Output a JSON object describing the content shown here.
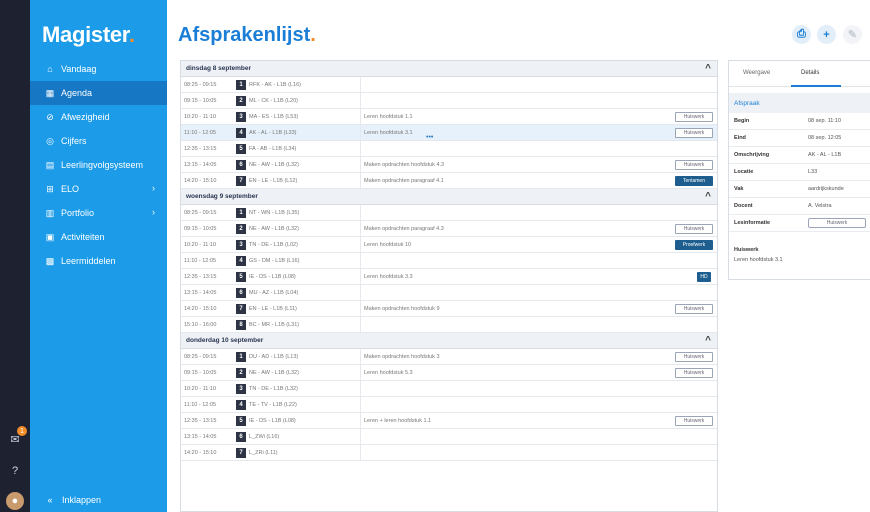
{
  "app": {
    "logo": "Magister",
    "logo_dot": "."
  },
  "strip": {
    "badge_count": "1"
  },
  "sidebar": {
    "items": [
      {
        "label": "Vandaag",
        "icon": "home-icon",
        "glyph": "⌂"
      },
      {
        "label": "Agenda",
        "icon": "calendar-icon",
        "glyph": "▦",
        "active": true
      },
      {
        "label": "Afwezigheid",
        "icon": "check-circle-icon",
        "glyph": "⊘"
      },
      {
        "label": "Cijfers",
        "icon": "grades-icon",
        "glyph": "◎"
      },
      {
        "label": "Leerlingvolgsysteem",
        "icon": "report-icon",
        "glyph": "▤"
      },
      {
        "label": "ELO",
        "icon": "elo-icon",
        "glyph": "⊞",
        "chevron": "›"
      },
      {
        "label": "Portfolio",
        "icon": "portfolio-icon",
        "glyph": "▥",
        "chevron": "›"
      },
      {
        "label": "Activiteiten",
        "icon": "activities-icon",
        "glyph": "▣"
      },
      {
        "label": "Leermiddelen",
        "icon": "books-icon",
        "glyph": "▩"
      }
    ],
    "collapse_label": "Inklappen",
    "collapse_glyph": "«"
  },
  "header": {
    "title": "Afsprakenlijst",
    "title_dot": ".",
    "print_glyph": "⎙",
    "add_glyph": "+",
    "edit_glyph": "✎"
  },
  "schedule": {
    "days": [
      {
        "label": "dinsdag 8 september",
        "rows": [
          {
            "time": "08:25 - 09:15",
            "hour": "1",
            "cls": "RFK - AK - L1B (L16)",
            "info": ""
          },
          {
            "time": "09:15 - 10:05",
            "hour": "2",
            "cls": "ML - CK - L1B (L20)",
            "info": ""
          },
          {
            "time": "10:20 - 11:10",
            "hour": "3",
            "cls": "MA - ES - L1B (L53)",
            "info": "Leren hoofdstuk 1.1",
            "badge": "Huiswerk",
            "badge_type": "outline"
          },
          {
            "time": "11:10 - 12:05",
            "hour": "4",
            "cls": "AK - AL - L1B (L33)",
            "info": "Leren hoofdstuk 3.1",
            "badge": "Huiswerk",
            "badge_type": "outline",
            "selected": true,
            "dots": "•••"
          },
          {
            "time": "12:35 - 13:15",
            "hour": "5",
            "cls": "FA - AB - L1B (L34)",
            "info": ""
          },
          {
            "time": "13:15 - 14:05",
            "hour": "6",
            "cls": "NE - AW - L1B (L32)",
            "info": "Maken opdrachten hoofdstuk 4.3",
            "badge": "Huiswerk",
            "badge_type": "outline"
          },
          {
            "time": "14:20 - 15:10",
            "hour": "7",
            "cls": "EN - LE - L1B (L12)",
            "info": "Maken opdrachten paragraaf 4.1",
            "badge": "Tentamen",
            "badge_type": "solid"
          }
        ]
      },
      {
        "label": "woensdag 9 september",
        "rows": [
          {
            "time": "08:25 - 09:15",
            "hour": "1",
            "cls": "NT - WN - L1B (L35)",
            "info": ""
          },
          {
            "time": "09:15 - 10:05",
            "hour": "2",
            "cls": "NE - AW - L1B (L32)",
            "info": "Maken opdrachten paragraaf 4.3",
            "badge": "Huiswerk",
            "badge_type": "outline"
          },
          {
            "time": "10:20 - 11:10",
            "hour": "3",
            "cls": "TN - DE - L1B (L02)",
            "info": "Leren hoofdstuk 10",
            "badge": "Proefwerk",
            "badge_type": "solid"
          },
          {
            "time": "11:10 - 12:05",
            "hour": "4",
            "cls": "GS - DM - L1B (L16)",
            "info": ""
          },
          {
            "time": "12:35 - 13:15",
            "hour": "5",
            "cls": "IE - DS - L1B (L08)",
            "info": "Leren hoofdstuk 3.3",
            "badge": "HD",
            "badge_type": "mini"
          },
          {
            "time": "13:15 - 14:05",
            "hour": "6",
            "cls": "MU - AZ - L1B (L04)",
            "info": ""
          },
          {
            "time": "14:20 - 15:10",
            "hour": "7",
            "cls": "EN - LE - L1B (L11)",
            "info": "Maken opdrachten hoofdstuk 9",
            "badge": "Huiswerk",
            "badge_type": "outline"
          },
          {
            "time": "15:10 - 16:00",
            "hour": "8",
            "cls": "BC - MR - L1B (L31)",
            "info": ""
          }
        ]
      },
      {
        "label": "donderdag 10 september",
        "rows": [
          {
            "time": "08:25 - 09:15",
            "hour": "1",
            "cls": "DU - AD - L1B (L13)",
            "info": "Maken opdrachten hoofdstuk 3",
            "badge": "Huiswerk",
            "badge_type": "outline"
          },
          {
            "time": "09:15 - 10:05",
            "hour": "2",
            "cls": "NE - AW - L1B (L32)",
            "info": "Leren hoofdstuk 5.3",
            "badge": "Huiswerk",
            "badge_type": "outline"
          },
          {
            "time": "10:20 - 11:10",
            "hour": "3",
            "cls": "TN - DE - L1B (L32)",
            "info": ""
          },
          {
            "time": "11:10 - 12:05",
            "hour": "4",
            "cls": "TE - TV - L1B (L22)",
            "info": ""
          },
          {
            "time": "12:35 - 13:15",
            "hour": "5",
            "cls": "IE - DS - L1B (L08)",
            "info": "Leren + leren hoofdstuk 1.1",
            "badge": "Huiswerk",
            "badge_type": "outline"
          },
          {
            "time": "13:15 - 14:05",
            "hour": "6",
            "cls": "L_ZWi (L16)",
            "info": ""
          },
          {
            "time": "14:20 - 15:10",
            "hour": "7",
            "cls": "L_ZRi (L11)",
            "info": ""
          }
        ]
      }
    ],
    "collapse_glyph": "^"
  },
  "details": {
    "tabs": [
      "Weergave",
      "Details"
    ],
    "section_title": "Afspraak",
    "section_chevron": "‹",
    "rows": [
      {
        "label": "Begin",
        "value": "08 sep. 11:10"
      },
      {
        "label": "Eind",
        "value": "08 sep. 12:05"
      },
      {
        "label": "Omschrijving",
        "value": "AK - AL - L1B"
      },
      {
        "label": "Locatie",
        "value": "L33"
      },
      {
        "label": "Vak",
        "value": "aardrijkskunde"
      },
      {
        "label": "Docent",
        "value": "A. Velstra"
      }
    ],
    "lesinfo_label": "Lesinformatie",
    "lesinfo_button": "Huiswerk",
    "homework_title": "Huiswerk",
    "homework_text": "Leren hoofdstuk 3.1"
  }
}
